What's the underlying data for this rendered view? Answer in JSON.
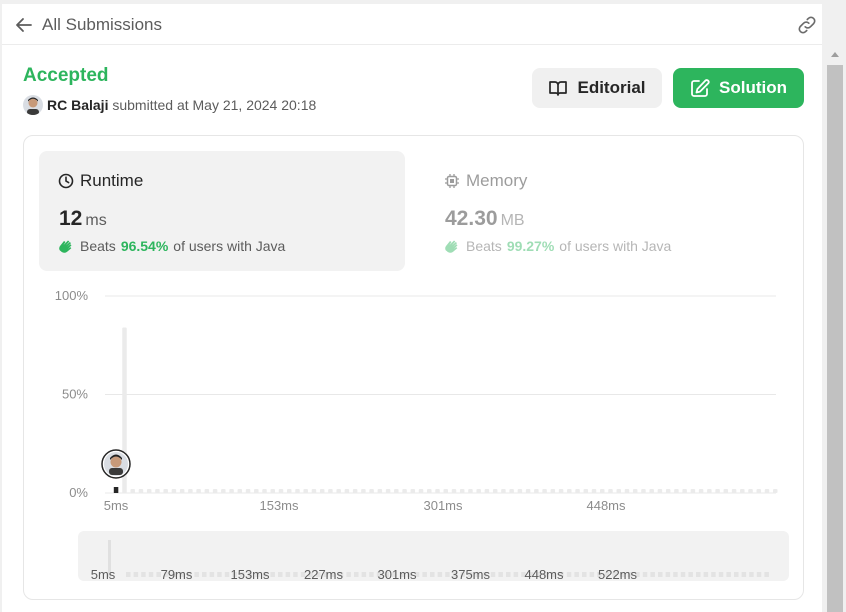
{
  "header": {
    "back_label": "All Submissions",
    "back_icon": "arrow-left-icon",
    "share_icon": "link-icon"
  },
  "submission": {
    "status": "Accepted",
    "author": "RC Balaji",
    "submitted_text": "submitted at May 21, 2024 20:18"
  },
  "actions": {
    "editorial_label": "Editorial",
    "solution_label": "Solution"
  },
  "runtime": {
    "title": "Runtime",
    "value": "12",
    "unit": "ms",
    "beats_prefix": "Beats",
    "beats_pct": "96.54%",
    "beats_suffix": "of users with Java"
  },
  "memory": {
    "title": "Memory",
    "value": "42.30",
    "unit": "MB",
    "beats_prefix": "Beats",
    "beats_pct": "99.27%",
    "beats_suffix": "of users with Java"
  },
  "colors": {
    "accent": "#2db55d",
    "text": "#262626",
    "muted": "#5c5c5c",
    "tile_bg": "#f2f2f2"
  },
  "chart_data": {
    "type": "bar",
    "yticks": [
      "100%",
      "50%",
      "0%"
    ],
    "ylim": [
      0,
      100
    ],
    "xticks": [
      "5ms",
      "153ms",
      "301ms",
      "448ms"
    ],
    "values": [
      2,
      84,
      1,
      1,
      1,
      1,
      1,
      1,
      1,
      1,
      1,
      1,
      1,
      1,
      1,
      1,
      1,
      1,
      1,
      1,
      1,
      1,
      1,
      1,
      1,
      1,
      1,
      1,
      1,
      1,
      1,
      1,
      1,
      1,
      1,
      1,
      1,
      1,
      1,
      1,
      1,
      1,
      1,
      1,
      1,
      1,
      1,
      1,
      1,
      1,
      1,
      1,
      1,
      1,
      1,
      1,
      1,
      1,
      1,
      1,
      1,
      1,
      1,
      1,
      1,
      1,
      1,
      1,
      1,
      1,
      1,
      1,
      1,
      1,
      1,
      1,
      1,
      1,
      1,
      1,
      1
    ],
    "highlight_index": 0,
    "brush_ticks": [
      "5ms",
      "79ms",
      "153ms",
      "227ms",
      "301ms",
      "375ms",
      "448ms",
      "522ms"
    ],
    "grid": true
  }
}
